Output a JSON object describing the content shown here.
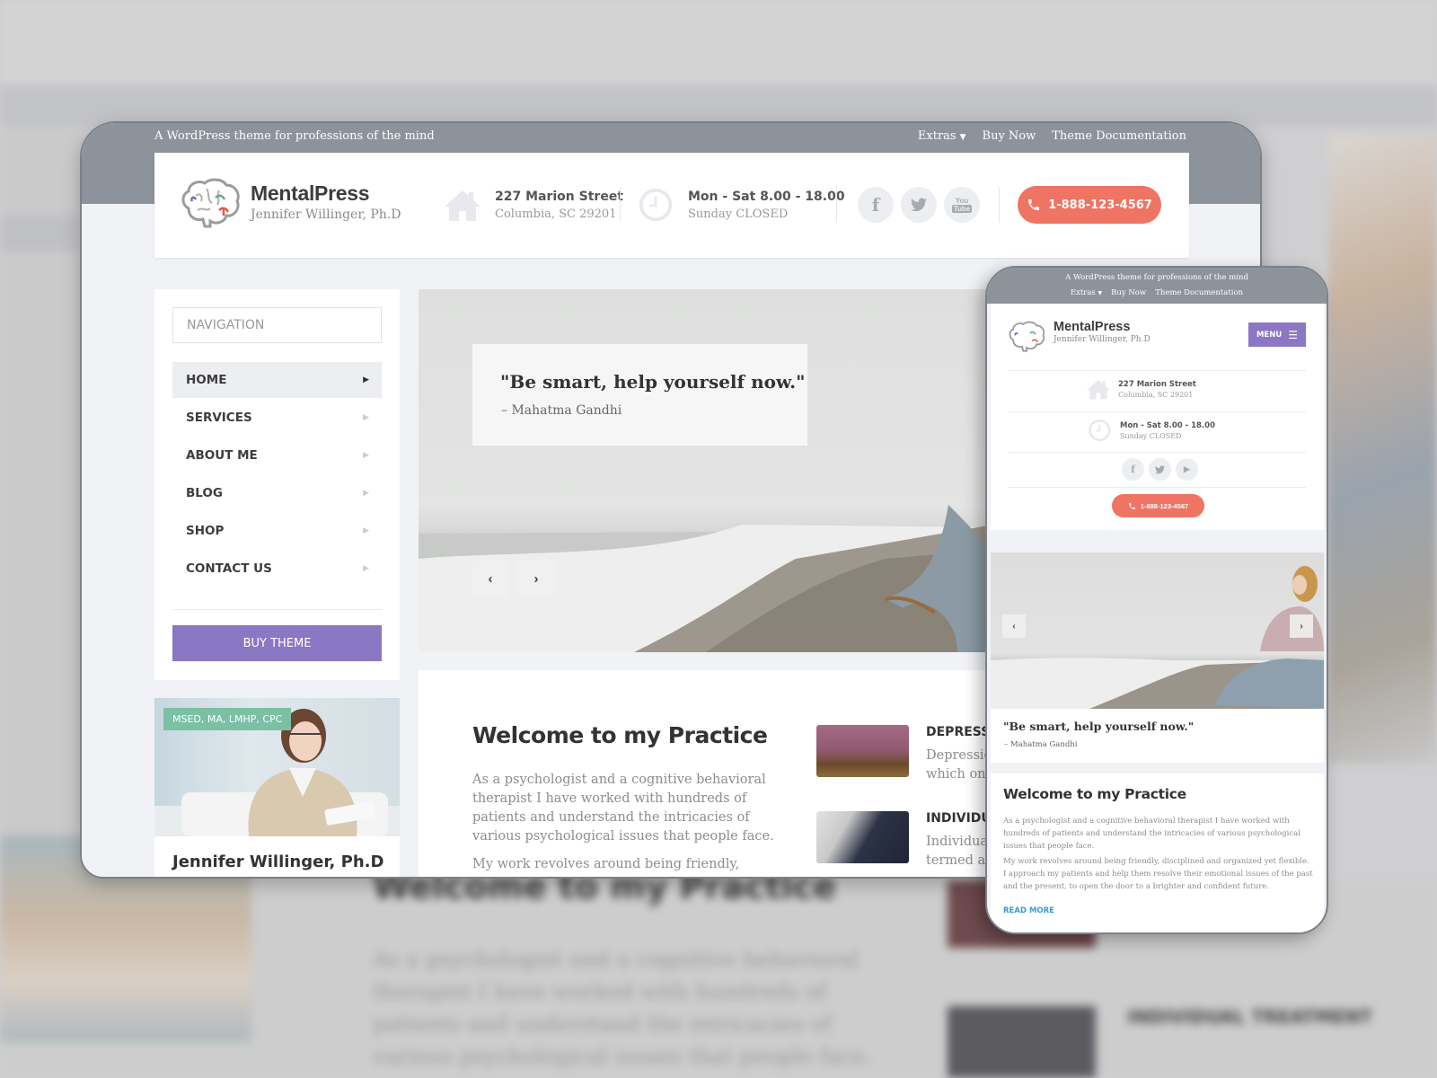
{
  "colors": {
    "topbar": "#8d939b",
    "accent_purple": "#8b77c3",
    "accent_coral": "#ef7463",
    "badge_green": "#7bc0a3",
    "link_blue": "#3a9bd1"
  },
  "backdrop": {
    "title": "Welcome to my Practice",
    "para": "As a psychologist and a cognitive behavioral therapist I have worked with hundreds of patients and understand the intricacies of various psychological issues that people face.",
    "service": "INDIVIDUAL TREATMENT"
  },
  "desktop": {
    "tagline": "A WordPress theme for professions of the mind",
    "top_links": [
      "Extras",
      "Buy Now",
      "Theme Documentation"
    ],
    "brand_name": "MentalPress",
    "brand_sub": "Jennifer Willinger, Ph.D",
    "address": {
      "main": "227 Marion Street",
      "sub": "Columbia, SC 29201",
      "icon": "home-icon"
    },
    "hours": {
      "main": "Mon - Sat 8.00 - 18.00",
      "sub": "Sunday CLOSED",
      "icon": "clock-icon"
    },
    "social": [
      {
        "name": "facebook-icon",
        "glyph": "f"
      },
      {
        "name": "twitter-icon",
        "glyph": "🐦"
      },
      {
        "name": "youtube-icon",
        "glyph": "▶"
      }
    ],
    "phone": "1-888-123-4567",
    "nav_placeholder": "NAVIGATION",
    "menu": [
      {
        "label": "HOME",
        "active": true
      },
      {
        "label": "SERVICES",
        "active": false
      },
      {
        "label": "ABOUT ME",
        "active": false
      },
      {
        "label": "BLOG",
        "active": false
      },
      {
        "label": "SHOP",
        "active": false
      },
      {
        "label": "CONTACT US",
        "active": false
      }
    ],
    "buy_theme": "BUY THEME",
    "profile_badge": "MSED, MA, LMHP, CPC",
    "profile_name": "Jennifer Willinger, Ph.D",
    "quote": "\"Be smart, help yourself now.\"",
    "quote_author": "– Mahatma Gandhi",
    "prev_glyph": "‹",
    "next_glyph": "›",
    "welcome_title": "Welcome to my Practice",
    "welcome_p1": "As a psychologist and a cognitive behavioral therapist I have worked with hundreds of patients and understand the intricacies of various psychological issues that people face.",
    "welcome_p2": "My work revolves around being friendly, disciplined",
    "services": [
      {
        "title": "DEPRESSION",
        "desc1": "Depression",
        "desc2": "which one"
      },
      {
        "title": "INDIVIDUAL",
        "desc1": "Individual",
        "desc2": "termed as"
      }
    ]
  },
  "tablet": {
    "tagline": "A WordPress theme for professions of the mind",
    "top_links": [
      "Extras",
      "Buy Now",
      "Theme Documentation"
    ],
    "brand_name": "MentalPress",
    "brand_sub": "Jennifer Willinger, Ph.D",
    "menu_label": "MENU",
    "address": {
      "main": "227 Marion Street",
      "sub": "Columbia, SC 29201"
    },
    "hours": {
      "main": "Mon - Sat 8.00 - 18.00",
      "sub": "Sunday CLOSED"
    },
    "phone": "1-888-123-4567",
    "quote": "\"Be smart, help yourself now.\"",
    "quote_author": "– Mahatma Gandhi",
    "welcome_title": "Welcome to my Practice",
    "welcome_p1": "As a psychologist and a cognitive behavioral therapist I have worked with hundreds of patients and understand the intricacies of various psychological issues that people face.",
    "welcome_p2": "My work revolves around being friendly, disciplined and organized yet flexible. I approach my patients and help them resolve their emotional issues of the past and the present, to open the door to a brighter and confident future.",
    "read_more": "READ MORE"
  }
}
